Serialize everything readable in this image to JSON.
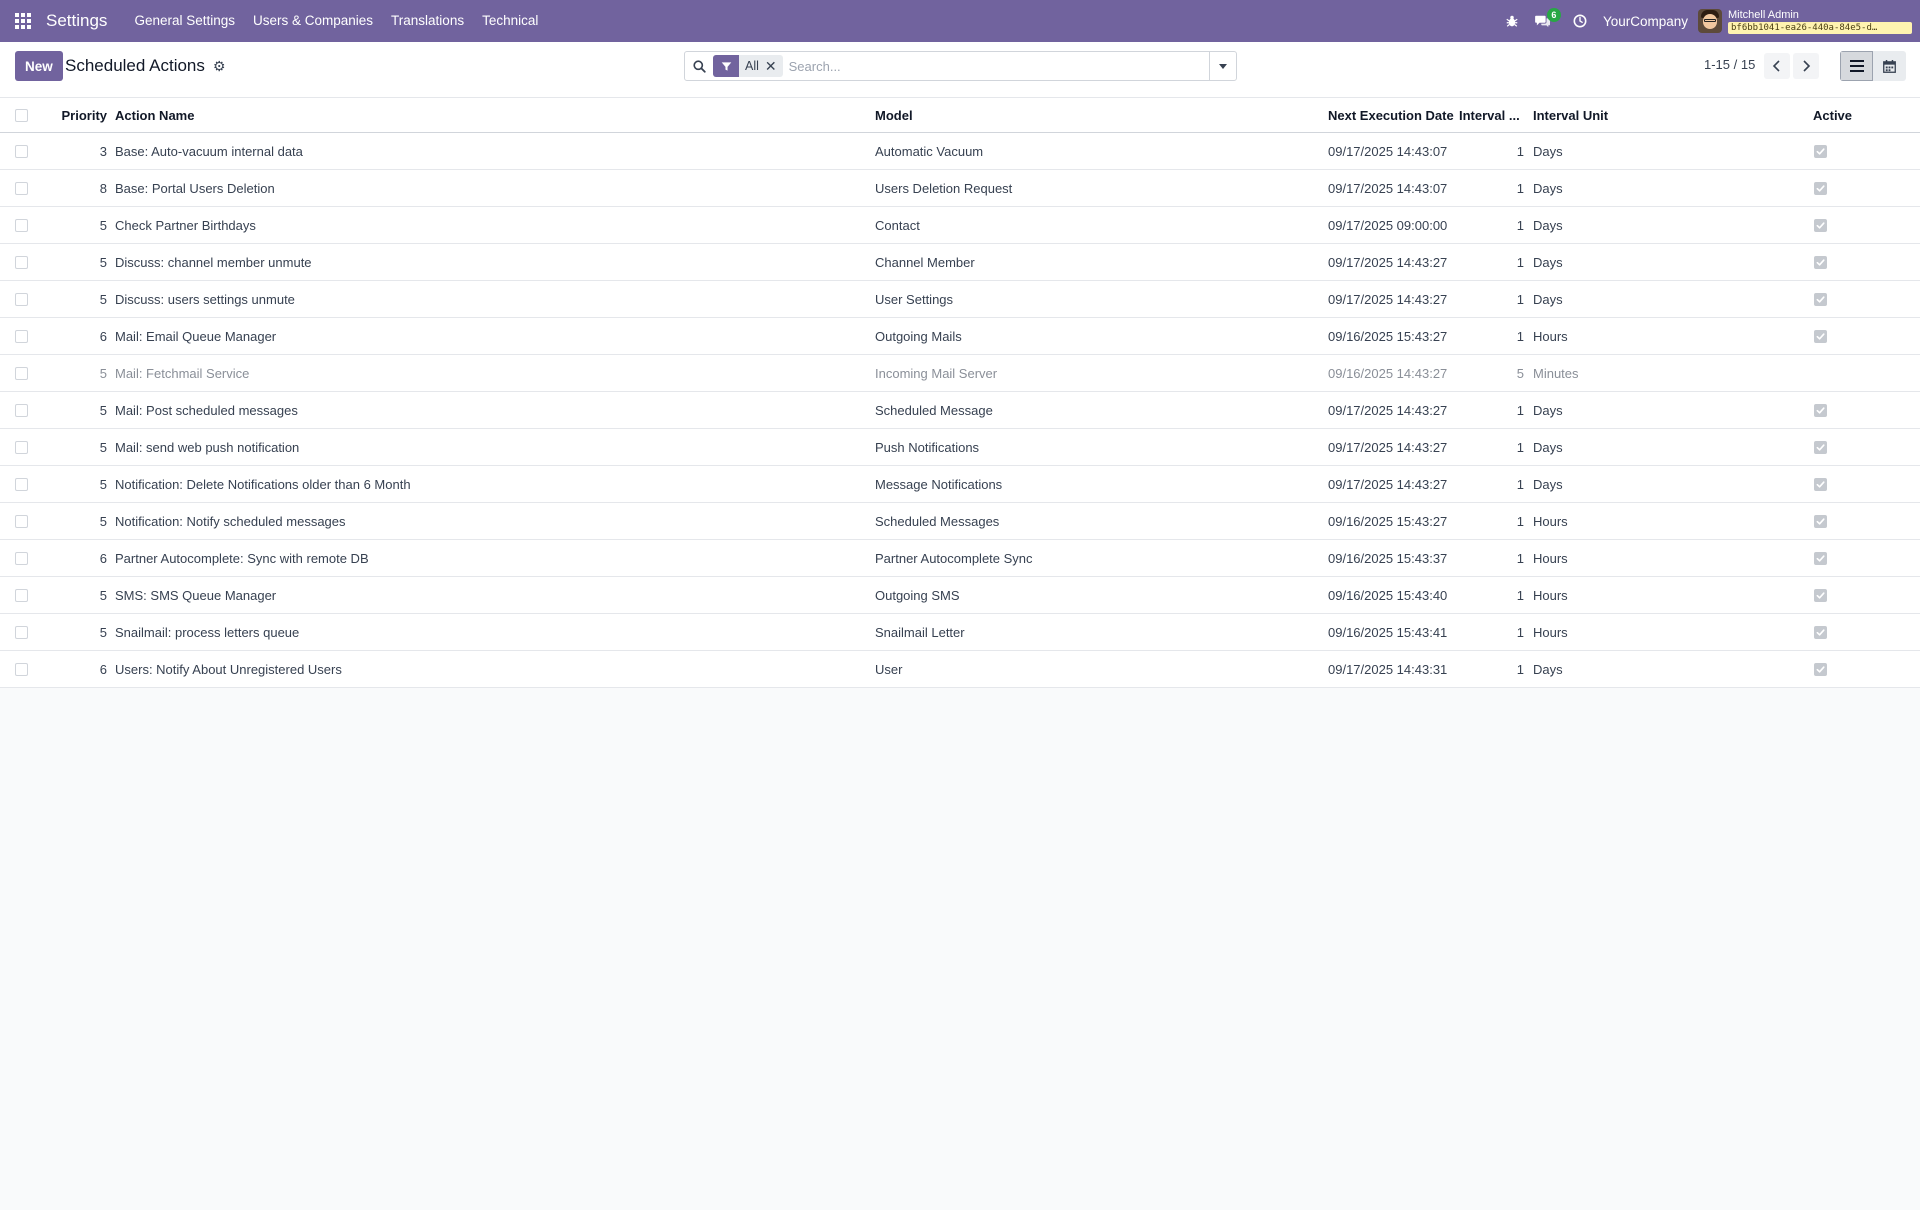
{
  "navbar": {
    "app_name": "Settings",
    "menu": [
      "General Settings",
      "Users & Companies",
      "Translations",
      "Technical"
    ],
    "messages_badge": "6",
    "company": "YourCompany",
    "user_name": "Mitchell Admin",
    "db_name": "bf6bb1041-ea26-440a-84e5-d…"
  },
  "control_panel": {
    "new_label": "New",
    "title": "Scheduled Actions",
    "facet_label": "All",
    "search_placeholder": "Search...",
    "pager": "1-15 / 15"
  },
  "table": {
    "columns": {
      "priority": "Priority",
      "action_name": "Action Name",
      "model": "Model",
      "next_execution": "Next Execution Date",
      "interval": "Interval ...",
      "interval_unit": "Interval Unit",
      "active": "Active"
    },
    "rows": [
      {
        "priority": "3",
        "name": "Base: Auto-vacuum internal data",
        "model": "Automatic Vacuum",
        "date": "09/17/2025 14:43:07",
        "interval": "1",
        "unit": "Days",
        "active": true
      },
      {
        "priority": "8",
        "name": "Base: Portal Users Deletion",
        "model": "Users Deletion Request",
        "date": "09/17/2025 14:43:07",
        "interval": "1",
        "unit": "Days",
        "active": true
      },
      {
        "priority": "5",
        "name": "Check Partner Birthdays",
        "model": "Contact",
        "date": "09/17/2025 09:00:00",
        "interval": "1",
        "unit": "Days",
        "active": true
      },
      {
        "priority": "5",
        "name": "Discuss: channel member unmute",
        "model": "Channel Member",
        "date": "09/17/2025 14:43:27",
        "interval": "1",
        "unit": "Days",
        "active": true
      },
      {
        "priority": "5",
        "name": "Discuss: users settings unmute",
        "model": "User Settings",
        "date": "09/17/2025 14:43:27",
        "interval": "1",
        "unit": "Days",
        "active": true
      },
      {
        "priority": "6",
        "name": "Mail: Email Queue Manager",
        "model": "Outgoing Mails",
        "date": "09/16/2025 15:43:27",
        "interval": "1",
        "unit": "Hours",
        "active": true
      },
      {
        "priority": "5",
        "name": "Mail: Fetchmail Service",
        "model": "Incoming Mail Server",
        "date": "09/16/2025 14:43:27",
        "interval": "5",
        "unit": "Minutes",
        "active": false
      },
      {
        "priority": "5",
        "name": "Mail: Post scheduled messages",
        "model": "Scheduled Message",
        "date": "09/17/2025 14:43:27",
        "interval": "1",
        "unit": "Days",
        "active": true
      },
      {
        "priority": "5",
        "name": "Mail: send web push notification",
        "model": "Push Notifications",
        "date": "09/17/2025 14:43:27",
        "interval": "1",
        "unit": "Days",
        "active": true
      },
      {
        "priority": "5",
        "name": "Notification: Delete Notifications older than 6 Month",
        "model": "Message Notifications",
        "date": "09/17/2025 14:43:27",
        "interval": "1",
        "unit": "Days",
        "active": true
      },
      {
        "priority": "5",
        "name": "Notification: Notify scheduled messages",
        "model": "Scheduled Messages",
        "date": "09/16/2025 15:43:27",
        "interval": "1",
        "unit": "Hours",
        "active": true
      },
      {
        "priority": "6",
        "name": "Partner Autocomplete: Sync with remote DB",
        "model": "Partner Autocomplete Sync",
        "date": "09/16/2025 15:43:37",
        "interval": "1",
        "unit": "Hours",
        "active": true
      },
      {
        "priority": "5",
        "name": "SMS: SMS Queue Manager",
        "model": "Outgoing SMS",
        "date": "09/16/2025 15:43:40",
        "interval": "1",
        "unit": "Hours",
        "active": true
      },
      {
        "priority": "5",
        "name": "Snailmail: process letters queue",
        "model": "Snailmail Letter",
        "date": "09/16/2025 15:43:41",
        "interval": "1",
        "unit": "Hours",
        "active": true
      },
      {
        "priority": "6",
        "name": "Users: Notify About Unregistered Users",
        "model": "User",
        "date": "09/17/2025 14:43:31",
        "interval": "1",
        "unit": "Days",
        "active": true
      }
    ]
  },
  "colors": {
    "brand": "#71639e",
    "badge": "#28a745"
  },
  "icons": {
    "apps": "apps-grid-icon",
    "debug": "bug-icon",
    "messages": "chat-bubbles-icon",
    "activity": "clock-icon",
    "settings": "gear-icon",
    "search": "magnifier-icon",
    "filter": "funnel-icon",
    "remove": "close-icon",
    "dropdown": "caret-down-icon",
    "prev": "chevron-left-icon",
    "next": "chevron-right-icon",
    "list_view": "list-icon",
    "calendar_view": "calendar-icon"
  }
}
